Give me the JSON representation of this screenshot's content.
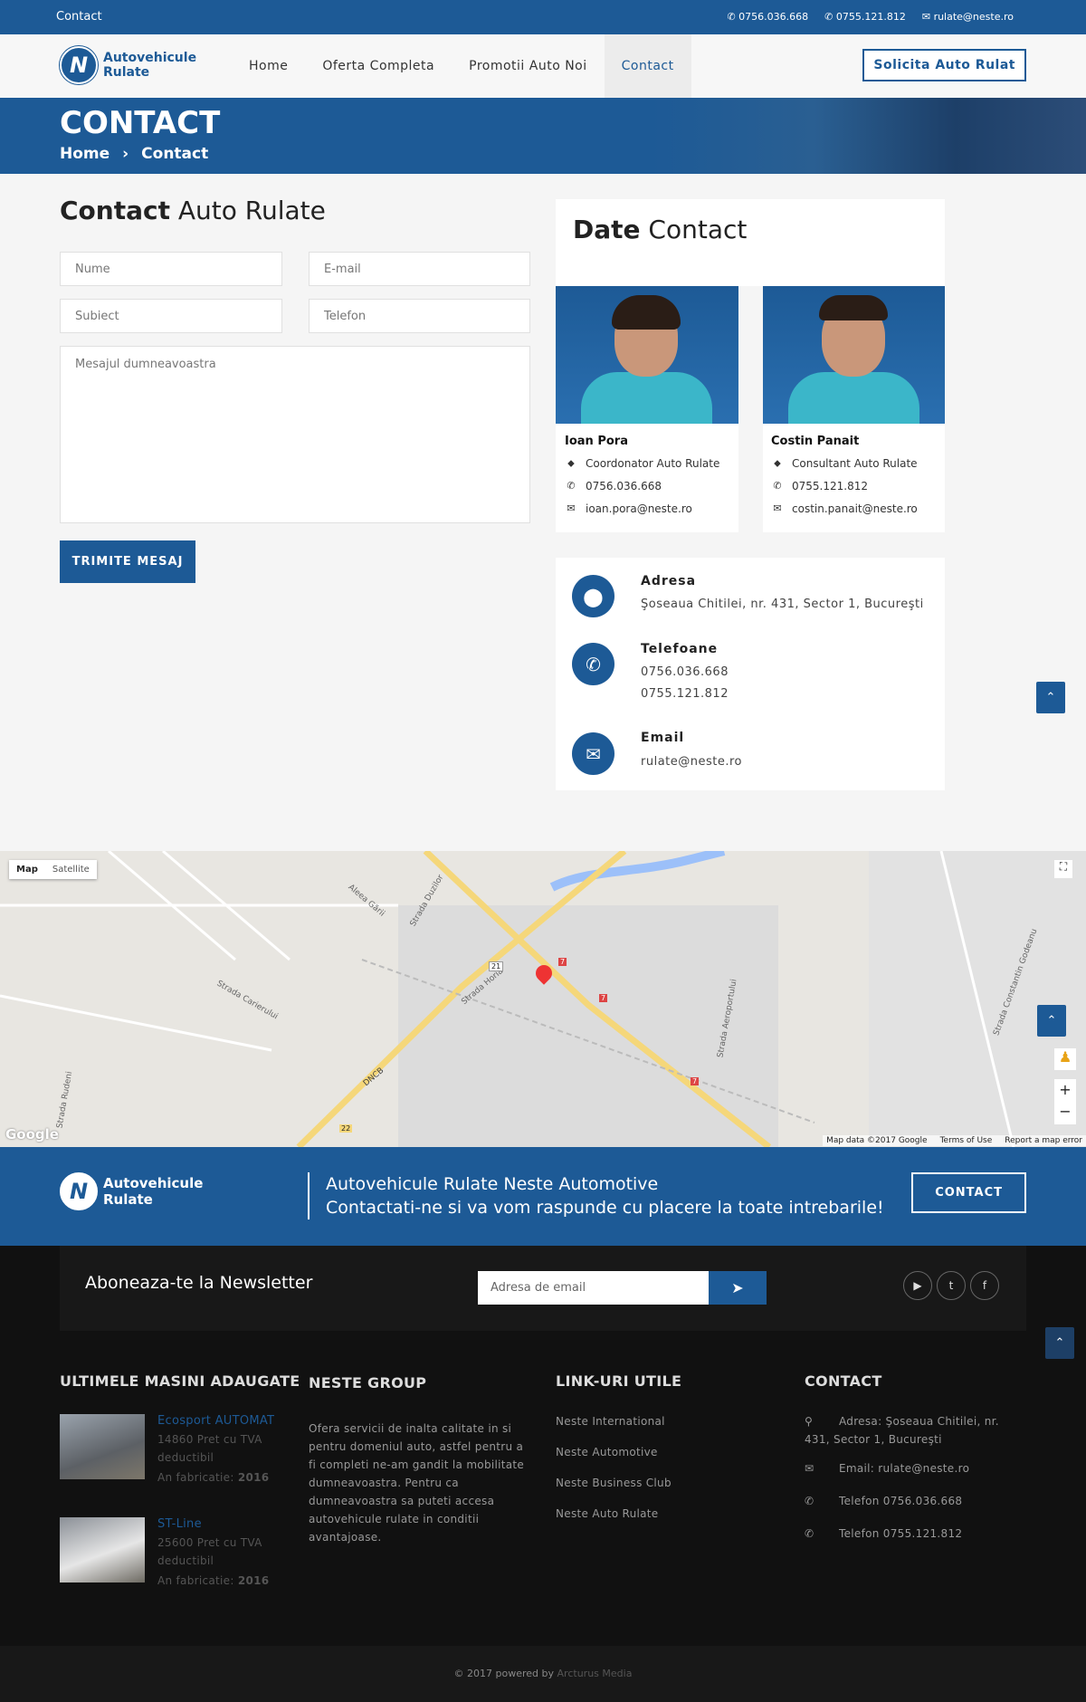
{
  "topbar": {
    "left": "Contact",
    "phone1": "0756.036.668",
    "phone2": "0755.121.812",
    "email": "rulate@neste.ro"
  },
  "logo": {
    "line1": "Autovehicule",
    "line2": "Rulate"
  },
  "nav": {
    "items": [
      "Home",
      "Oferta Completa",
      "Promotii Auto Noi",
      "Contact"
    ],
    "cta": "Solicita Auto Rulat"
  },
  "hero": {
    "title": "CONTACT",
    "breadcrumb": [
      "Home",
      "Contact"
    ],
    "sep": "›"
  },
  "form": {
    "title_bold": "Contact",
    "title_rest": " Auto Rulate",
    "name": "Nume",
    "email": "E-mail",
    "subject": "Subiect",
    "phone": "Telefon",
    "message": "Mesajul dumneavoastra",
    "submit": "TRIMITE MESAJ"
  },
  "contact_card": {
    "title_bold": "Date",
    "title_rest": " Contact",
    "people": [
      {
        "name": "Ioan Pora",
        "role": "Coordonator Auto Rulate",
        "phone": "0756.036.668",
        "email": "ioan.pora@neste.ro"
      },
      {
        "name": "Costin Panait",
        "role": "Consultant Auto Rulate",
        "phone": "0755.121.812",
        "email": "costin.panait@neste.ro"
      }
    ]
  },
  "info": {
    "address_label": "Adresa",
    "address": "Şoseaua Chitilei, nr. 431, Sector 1, Bucureşti",
    "phones_label": "Telefoane",
    "phone1": "0756.036.668",
    "phone2": "0755.121.812",
    "email_label": "Email",
    "email": "rulate@neste.ro"
  },
  "map": {
    "type_map": "Map",
    "type_sat": "Satellite",
    "google": "Google",
    "data": "Map data ©2017 Google",
    "terms": "Terms of Use",
    "report": "Report a map error",
    "labels": [
      "Strada Horia",
      "Strada Aeroportului",
      "Strada Carierului",
      "DNCB",
      "Strada Constantin Godeanu",
      "Strada Duzilor",
      "Aleea Gării",
      "Strada Rudeni"
    ],
    "road_numbers": [
      "21",
      "7",
      "7",
      "7",
      "22"
    ]
  },
  "cta": {
    "line1": "Autovehicule Rulate Neste Automotive",
    "line2": "Contactati-ne si va vom raspunde cu placere la toate intrebarile!",
    "button": "CONTACT"
  },
  "newsletter": {
    "title": "Aboneaza-te la Newsletter",
    "placeholder": "Adresa de email"
  },
  "footer": {
    "cars_title": "ULTIMELE MASINI ADAUGATE",
    "cars": [
      {
        "name": "Ecosport AUTOMAT",
        "price": "14860 Pret cu TVA deductibil",
        "year_label": "An fabricatie: ",
        "year": "2016"
      },
      {
        "name": "ST-Line",
        "price": "25600 Pret cu TVA deductibil",
        "year_label": "An fabricatie: ",
        "year": "2016"
      }
    ],
    "group_title": "NESTE GROUP",
    "group_text": "Ofera servicii de inalta calitate in si pentru domeniul auto, astfel pentru a fi completi ne-am gandit la mobilitate dumneavoastra. Pentru ca dumneavoastra sa puteti accesa autovehicule rulate in conditii avantajoase.",
    "links_title": "LINK-URI UTILE",
    "links": [
      "Neste International",
      "Neste Automotive",
      "Neste Business Club",
      "Neste Auto Rulate"
    ],
    "contact_title": "CONTACT",
    "contact": [
      "Adresa: Şoseaua Chitilei, nr. 431, Sector 1, Bucureşti",
      "Email: rulate@neste.ro",
      "Telefon 0756.036.668",
      "Telefon 0755.121.812"
    ]
  },
  "bottom": {
    "text": "© 2017 powered by ",
    "link": "Arcturus Media"
  },
  "colors": {
    "brand": "#1d5a96",
    "footer": "#111111"
  }
}
